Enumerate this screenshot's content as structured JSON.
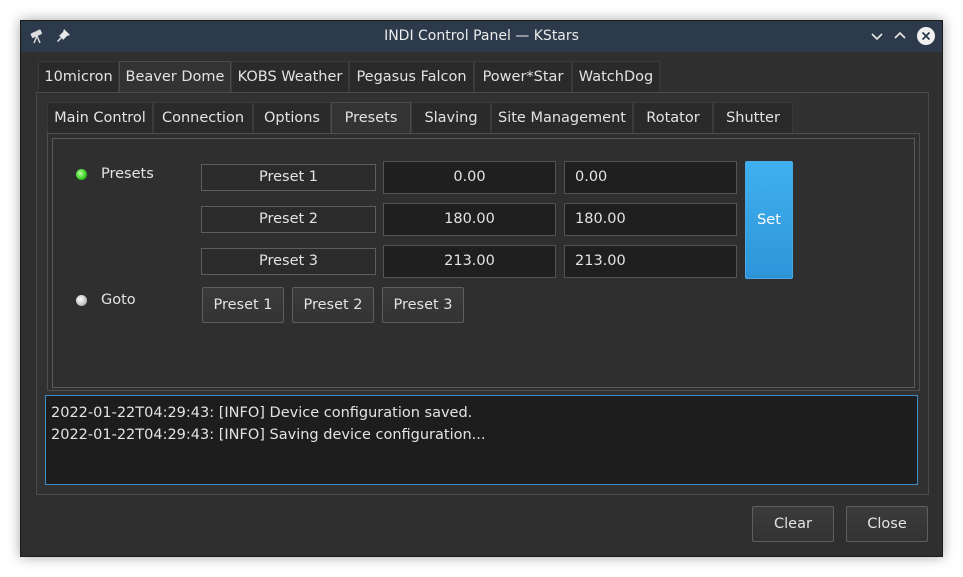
{
  "window": {
    "title": "INDI Control Panel — KStars",
    "icons": {
      "app": "telescope-icon",
      "pin": "pin-icon",
      "minimize": "chevron-down-icon",
      "maximize": "chevron-up-icon",
      "close": "close-icon"
    }
  },
  "device_tabs": [
    "10micron",
    "Beaver Dome",
    "KOBS Weather",
    "Pegasus Falcon",
    "Power*Star",
    "WatchDog"
  ],
  "active_device_tab": "Beaver Dome",
  "group_tabs": [
    "Main Control",
    "Connection",
    "Options",
    "Presets",
    "Slaving",
    "Site Management",
    "Rotator",
    "Shutter"
  ],
  "active_group_tab": "Presets",
  "presets": {
    "label": "Presets",
    "status": "ok",
    "rows": [
      {
        "name": "Preset 1",
        "value": "0.00",
        "target": "0.00"
      },
      {
        "name": "Preset 2",
        "value": "180.00",
        "target": "180.00"
      },
      {
        "name": "Preset 3",
        "value": "213.00",
        "target": "213.00"
      }
    ],
    "set_label": "Set"
  },
  "goto": {
    "label": "Goto",
    "status": "idle",
    "buttons": [
      "Preset 1",
      "Preset 2",
      "Preset 3"
    ]
  },
  "log": [
    "2022-01-22T04:29:43: [INFO] Device configuration saved.",
    "2022-01-22T04:29:43: [INFO] Saving device configuration..."
  ],
  "buttons": {
    "clear": "Clear",
    "close": "Close"
  },
  "colors": {
    "accent": "#3daee9",
    "ok_led": "#3fd02b",
    "idle_led": "#c9c9c9",
    "titlebar": "#2c3a4b",
    "background": "#2f2f2f"
  }
}
